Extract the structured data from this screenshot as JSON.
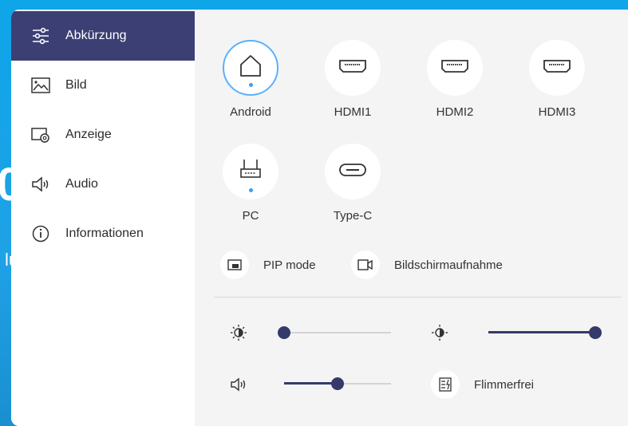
{
  "background": {
    "text_large": "0",
    "text_small": "lu"
  },
  "sidebar": {
    "items": [
      {
        "label": "Abkürzung",
        "icon": "sliders-icon",
        "active": true
      },
      {
        "label": "Bild",
        "icon": "image-icon",
        "active": false
      },
      {
        "label": "Anzeige",
        "icon": "display-settings-icon",
        "active": false
      },
      {
        "label": "Audio",
        "icon": "speaker-icon",
        "active": false
      },
      {
        "label": "Informationen",
        "icon": "info-icon",
        "active": false
      }
    ]
  },
  "sources": [
    {
      "label": "Android",
      "icon": "home-icon",
      "selected": true
    },
    {
      "label": "HDMI1",
      "icon": "hdmi-icon",
      "selected": false
    },
    {
      "label": "HDMI2",
      "icon": "hdmi-icon",
      "selected": false
    },
    {
      "label": "HDMI3",
      "icon": "hdmi-icon",
      "selected": false
    },
    {
      "label": "PC",
      "icon": "pc-module-icon",
      "selected": false
    },
    {
      "label": "Type-C",
      "icon": "usb-c-icon",
      "selected": false
    }
  ],
  "tools": {
    "pip_label": "PIP mode",
    "capture_label": "Bildschirmaufnahme"
  },
  "controls": {
    "brightness": 0,
    "contrast": 100,
    "volume": 50,
    "flicker_label": "Flimmerfrei"
  },
  "colors": {
    "accent": "#3b3f73",
    "highlight": "#3aa0f0",
    "background": "#f4f4f4"
  }
}
